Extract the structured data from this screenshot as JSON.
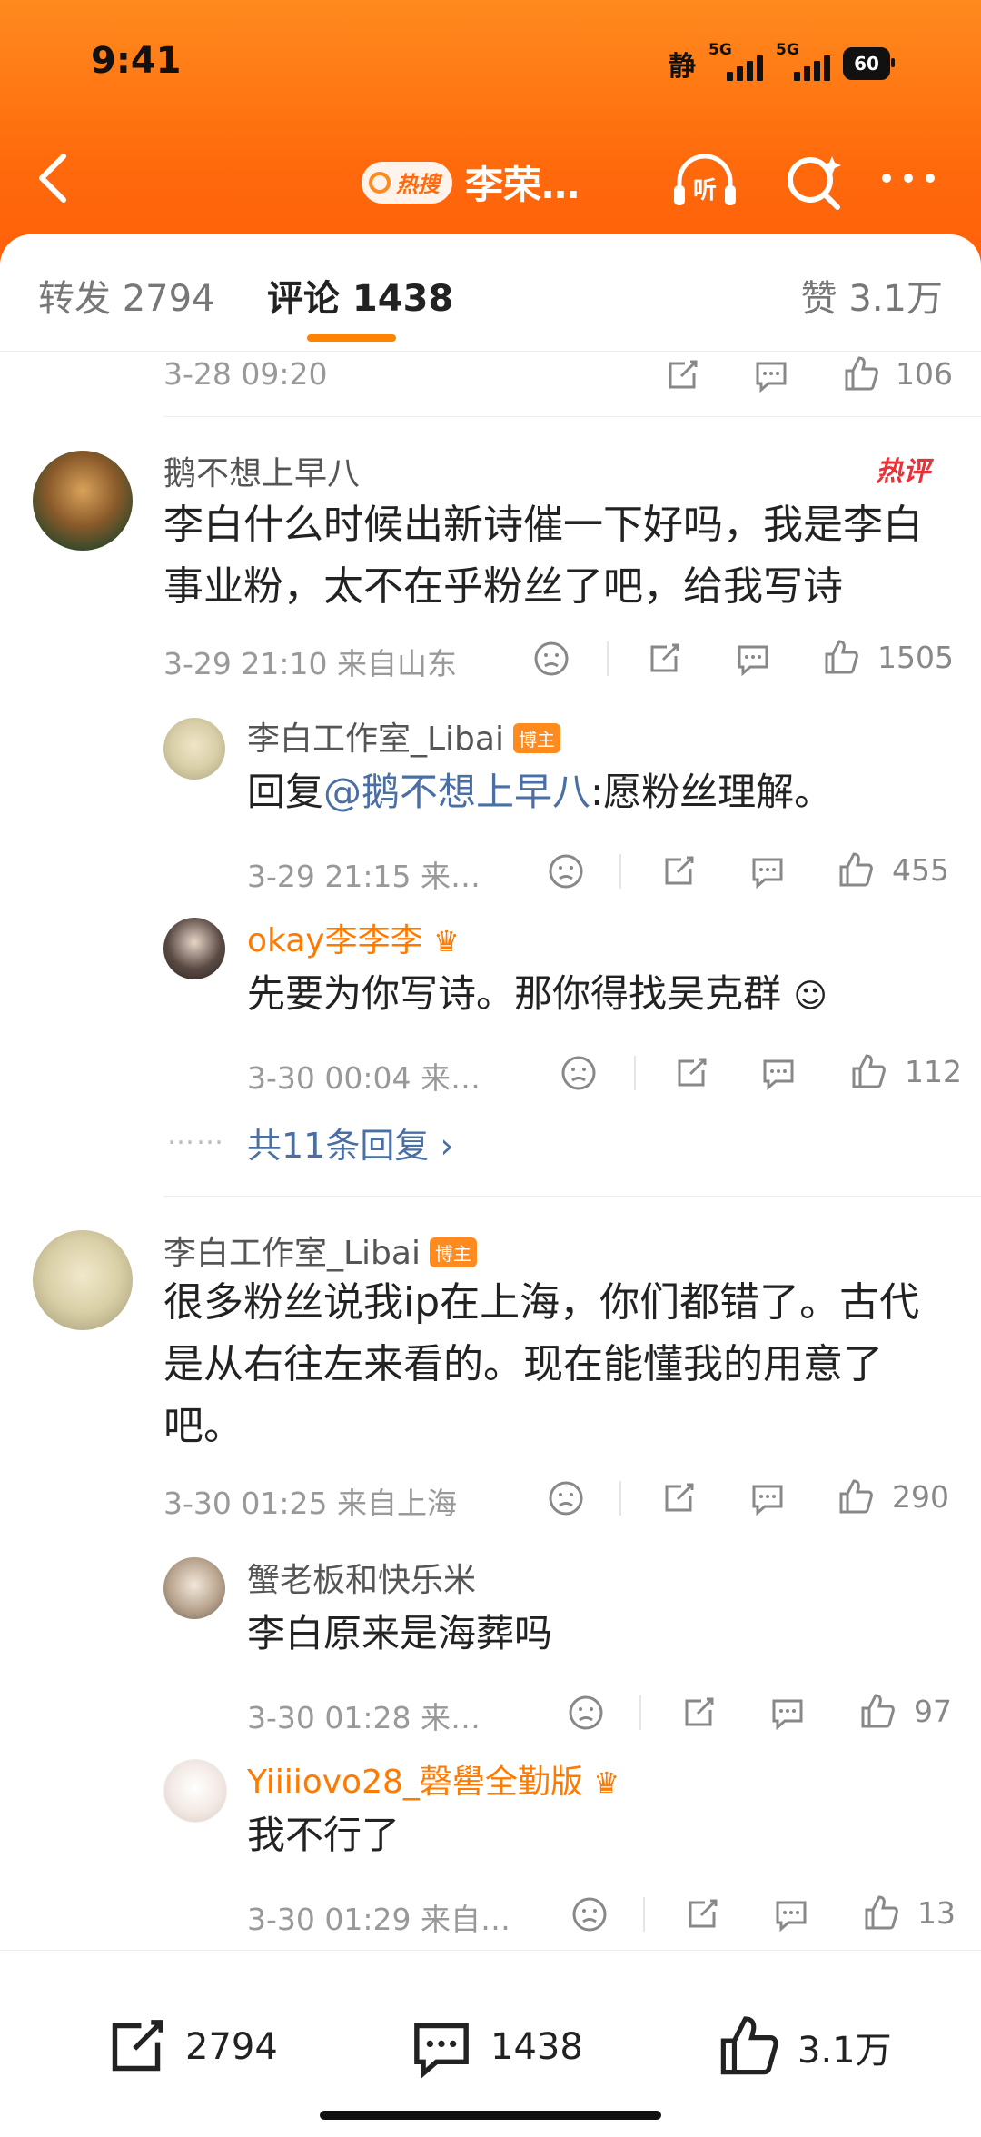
{
  "status_bar": {
    "time": "9:41",
    "mode": "静",
    "net1": "5G",
    "net2": "5G",
    "battery": "60"
  },
  "header": {
    "hot_label": "热搜",
    "title": "李荣…"
  },
  "tabs": {
    "repost": "转发 2794",
    "comments": "评论 1438",
    "likes": "赞 3.1万"
  },
  "prev_comment": {
    "time": "3-28 09:20",
    "likes": "106"
  },
  "comments": [
    {
      "user": "鹅不想上早八",
      "hot_tag": "热评",
      "text": "李白什么时候出新诗催一下好吗，我是李白事业粉，太不在乎粉丝了吧，给我写诗",
      "time": "3-29 21:10  来自山东",
      "likes": "1505",
      "replies": [
        {
          "user": "李白工作室_Libai",
          "badge": "博主",
          "prefix": "回复",
          "mention": "@鹅不想上早八",
          "text": ":愿粉丝理解。",
          "time": "3-29 21:15  来…",
          "likes": "455"
        },
        {
          "user": "okay李李李",
          "text": "先要为你写诗。那你得找吴克群",
          "time": "3-30 00:04  来…",
          "likes": "112"
        }
      ],
      "more_replies": "共11条回复 ›",
      "dots": "……"
    },
    {
      "user": "李白工作室_Libai",
      "badge": "博主",
      "text": "很多粉丝说我ip在上海，你们都错了。古代是从右往左来看的。现在能懂我的用意了吧。",
      "time": "3-30 01:25  来自上海",
      "likes": "290",
      "replies": [
        {
          "user": "蟹老板和快乐米",
          "text": "李白原来是海葬吗",
          "time": "3-30 01:28  来…",
          "likes": "97"
        },
        {
          "user": "Yiiiiovo28_磬嚳全勤版",
          "text": "我不行了",
          "time": "3-30 01:29  来自…",
          "likes": "13"
        }
      ]
    }
  ],
  "bottom_bar": {
    "reposts": "2794",
    "comments": "1438",
    "likes": "3.1万"
  },
  "colors": {
    "brand_orange": "#ff7a00",
    "link_blue": "#4a6fa5",
    "hot_red": "#e8323a"
  }
}
